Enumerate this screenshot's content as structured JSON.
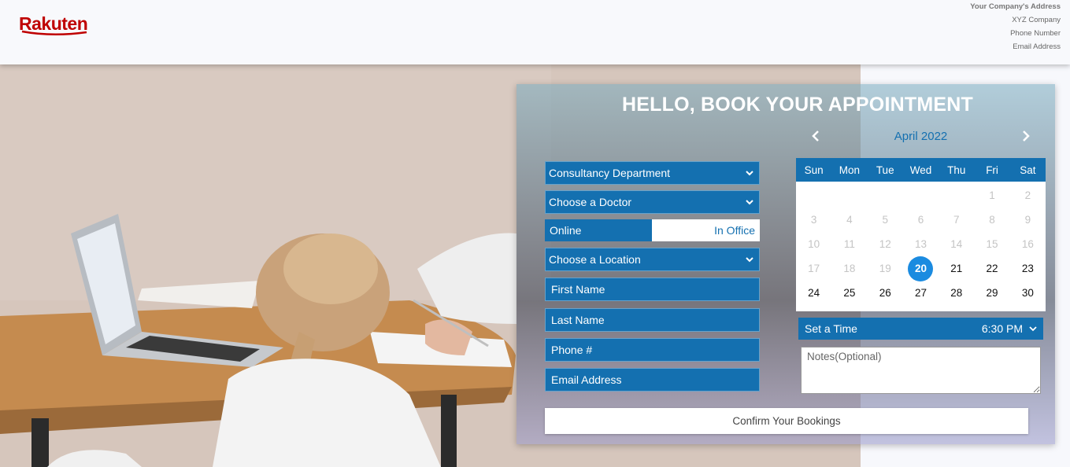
{
  "header": {
    "logo_text": "Rakuten",
    "address": {
      "title": "Your Company's Address",
      "company": "XYZ Company",
      "phone": "Phone Number",
      "email": "Email Address"
    }
  },
  "form": {
    "title": "HELLO, BOOK YOUR APPOINTMENT",
    "department_select": "Consultancy Department",
    "doctor_select": "Choose a Doctor",
    "mode_toggle": {
      "online": "Online",
      "in_office": "In Office"
    },
    "location_select": "Choose a Location",
    "first_name_placeholder": "First Name",
    "last_name_placeholder": "Last Name",
    "phone_placeholder": "Phone #",
    "email_placeholder": "Email Address",
    "notes_placeholder": "Notes(Optional)",
    "confirm_label": "Confirm Your Bookings"
  },
  "calendar": {
    "month_label": "April 2022",
    "weekdays": [
      "Sun",
      "Mon",
      "Tue",
      "Wed",
      "Thu",
      "Fri",
      "Sat"
    ],
    "days": [
      {
        "d": "",
        "dim": false
      },
      {
        "d": "",
        "dim": false
      },
      {
        "d": "",
        "dim": false
      },
      {
        "d": "",
        "dim": false
      },
      {
        "d": "",
        "dim": false
      },
      {
        "d": "1",
        "dim": true
      },
      {
        "d": "2",
        "dim": true
      },
      {
        "d": "3",
        "dim": true
      },
      {
        "d": "4",
        "dim": true
      },
      {
        "d": "5",
        "dim": true
      },
      {
        "d": "6",
        "dim": true
      },
      {
        "d": "7",
        "dim": true
      },
      {
        "d": "8",
        "dim": true
      },
      {
        "d": "9",
        "dim": true
      },
      {
        "d": "10",
        "dim": true
      },
      {
        "d": "11",
        "dim": true
      },
      {
        "d": "12",
        "dim": true
      },
      {
        "d": "13",
        "dim": true
      },
      {
        "d": "14",
        "dim": true
      },
      {
        "d": "15",
        "dim": true
      },
      {
        "d": "16",
        "dim": true
      },
      {
        "d": "17",
        "dim": true
      },
      {
        "d": "18",
        "dim": true
      },
      {
        "d": "19",
        "dim": true
      },
      {
        "d": "20",
        "dim": false,
        "selected": true
      },
      {
        "d": "21",
        "dim": false
      },
      {
        "d": "22",
        "dim": false
      },
      {
        "d": "23",
        "dim": false
      },
      {
        "d": "24",
        "dim": false
      },
      {
        "d": "25",
        "dim": false
      },
      {
        "d": "26",
        "dim": false
      },
      {
        "d": "27",
        "dim": false
      },
      {
        "d": "28",
        "dim": false
      },
      {
        "d": "29",
        "dim": false
      },
      {
        "d": "30",
        "dim": false
      }
    ]
  },
  "time": {
    "label": "Set a Time",
    "value": "6:30 PM"
  },
  "colors": {
    "primary": "#1470b0",
    "selected_day": "#1b8be0",
    "brand": "#bf0000"
  },
  "icons": {
    "calendar_prev": "chevron-left-icon",
    "calendar_next": "chevron-right-icon",
    "select_arrow": "chevron-down-icon"
  }
}
